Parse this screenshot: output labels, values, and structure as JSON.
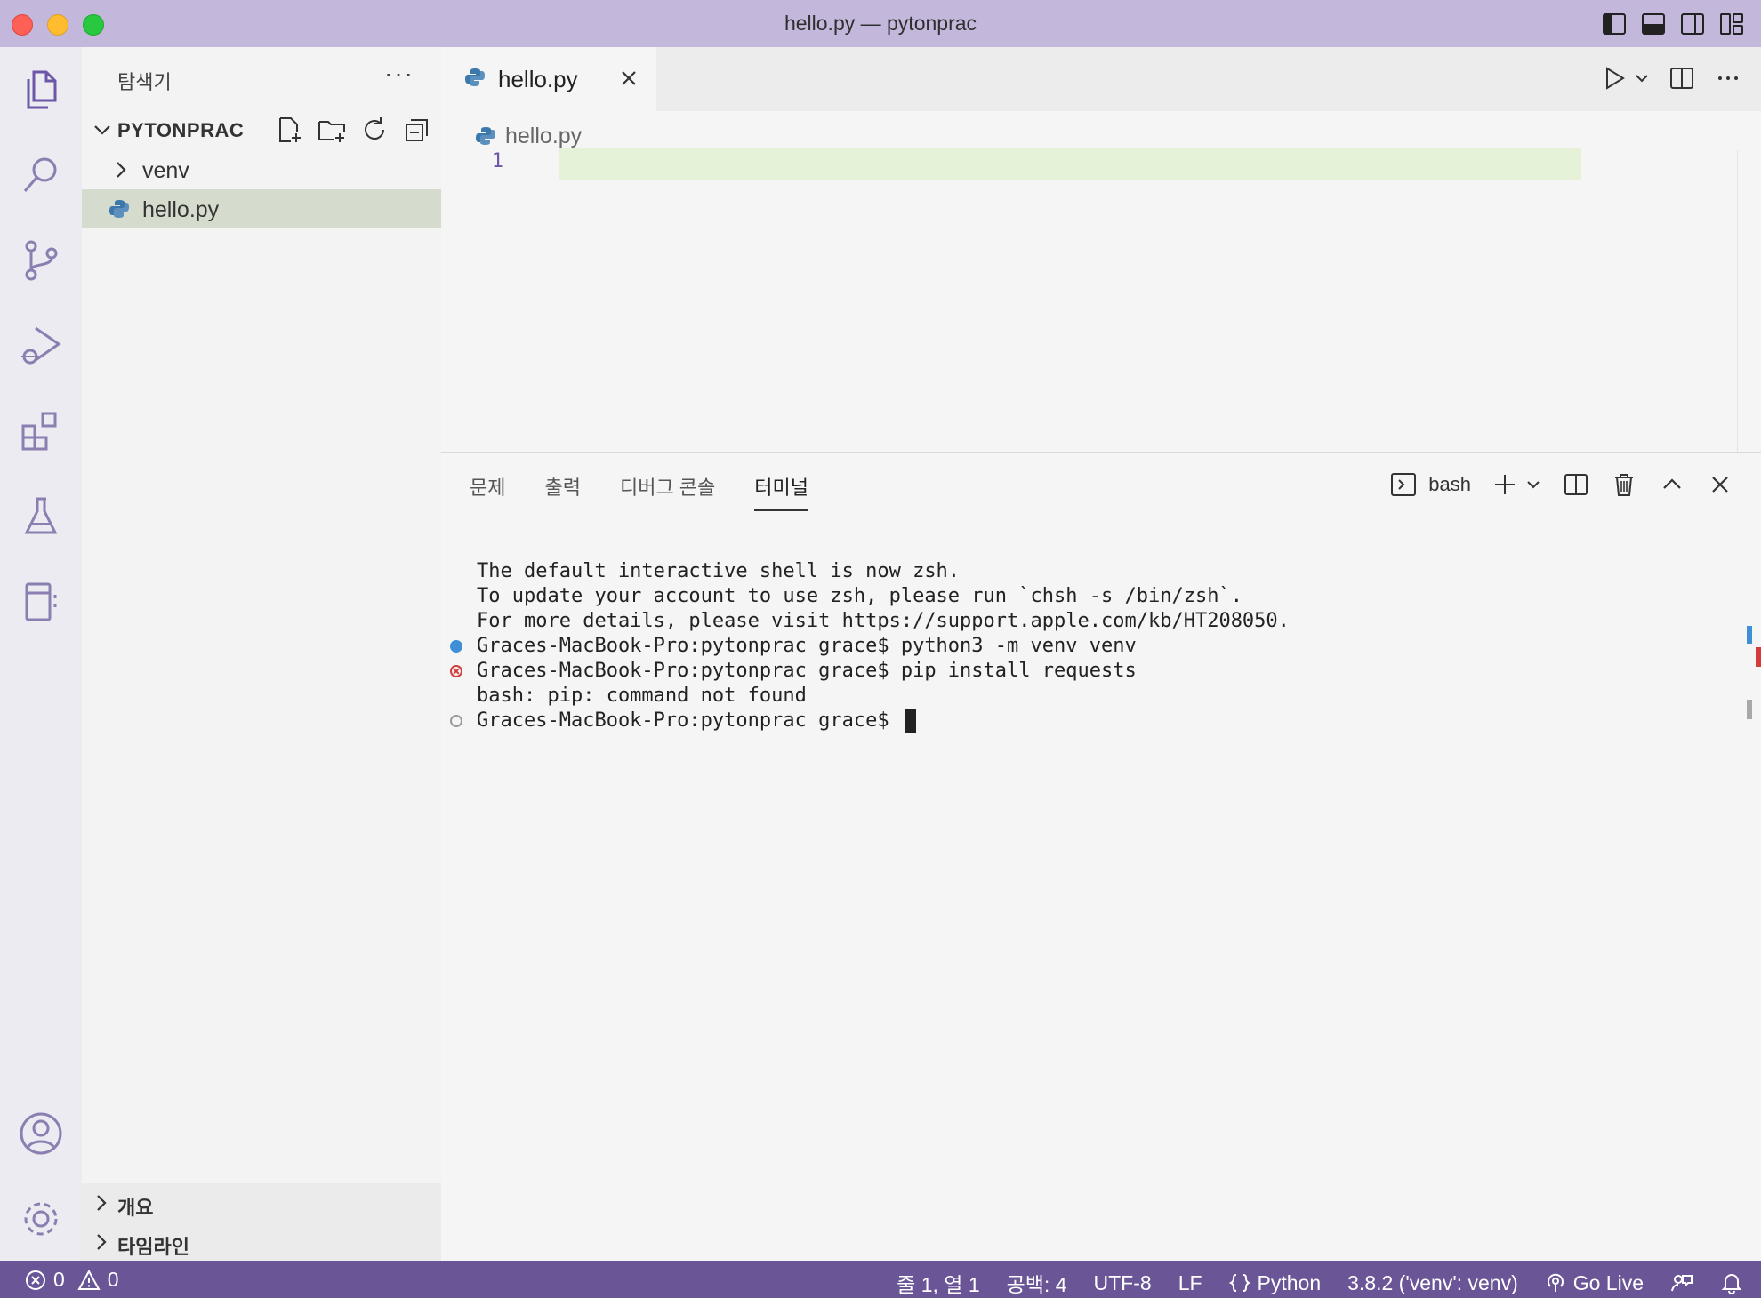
{
  "window": {
    "title": "hello.py — pytonprac"
  },
  "sidebar": {
    "title": "탐색기",
    "more": "···",
    "folder": "PYTONPRAC",
    "items": [
      {
        "label": "venv",
        "type": "folder"
      },
      {
        "label": "hello.py",
        "type": "python-file",
        "selected": true
      }
    ],
    "sections": [
      {
        "label": "개요"
      },
      {
        "label": "타임라인"
      }
    ]
  },
  "editor": {
    "tab": {
      "label": "hello.py"
    },
    "breadcrumb": "hello.py",
    "line_number": "1"
  },
  "panel": {
    "tabs": [
      "문제",
      "출력",
      "디버그 콘솔",
      "터미널"
    ],
    "active_tab": "터미널",
    "shell": "bash",
    "terminal": {
      "line1": "The default interactive shell is now zsh.",
      "line2": "To update your account to use zsh, please run `chsh -s /bin/zsh`.",
      "line3": "For more details, please visit https://support.apple.com/kb/HT208050.",
      "line4": "Graces-MacBook-Pro:pytonprac grace$ python3 -m venv venv",
      "line5": "Graces-MacBook-Pro:pytonprac grace$ pip install requests",
      "line6": "bash: pip: command not found",
      "line7": "Graces-MacBook-Pro:pytonprac grace$ "
    }
  },
  "statusbar": {
    "errors": "0",
    "warnings": "0",
    "position": "줄 1, 열 1",
    "spaces": "공백: 4",
    "encoding": "UTF-8",
    "eol": "LF",
    "language": "Python",
    "interpreter": "3.8.2 ('venv': venv)",
    "golive": "Go Live"
  },
  "colors": {
    "titlebar": "#c3b8dc",
    "statusbar": "#6a5596",
    "selection": "#d6dccd",
    "current_line": "#e6f2d8"
  }
}
